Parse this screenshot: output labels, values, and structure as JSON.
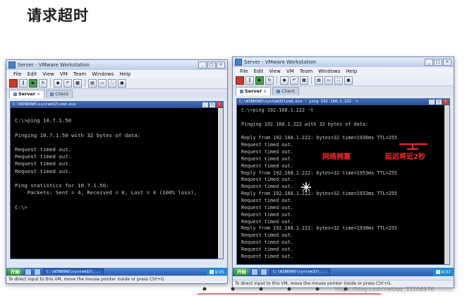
{
  "page": {
    "title": "请求超时"
  },
  "left_window": {
    "title": "Server - VMware Workstation",
    "menu": [
      "File",
      "Edit",
      "View",
      "VM",
      "Team",
      "Windows",
      "Help"
    ],
    "tabs": [
      {
        "label": "Server",
        "active": true
      },
      {
        "label": "Client",
        "active": false
      }
    ],
    "console_title": "C:\\WINDOWS\\system32\\cmd.exe",
    "lines": [
      "",
      "C:\\>ping 10.7.1.50",
      "",
      "Pinging 10.7.1.50 with 32 bytes of data:",
      "",
      "Request timed out.",
      "Request timed out.",
      "Request timed out.",
      "Request timed out.",
      "",
      "Ping statistics for 10.7.1.50:",
      "    Packets: Sent = 4, Received = 0, Lost = 4 (100% loss),",
      "",
      "C:\\>"
    ],
    "taskbar": {
      "start": "开始",
      "task": "C:\\WINDOWS\\system32\\...",
      "clock": "9:05"
    },
    "status": "To direct input to this VM, move the mouse pointer inside or press Ctrl+G."
  },
  "right_window": {
    "title": "Server - VMware Workstation",
    "menu": [
      "File",
      "Edit",
      "View",
      "VM",
      "Team",
      "Windows",
      "Help"
    ],
    "tabs": [
      {
        "label": "Server",
        "active": true
      },
      {
        "label": "Client",
        "active": false
      }
    ],
    "console_title": "C:\\WINDOWS\\system32\\cmd.exe - ping 192.168.1.222 -t",
    "lines": [
      "C:\\>ping 192.168.1.222 -t",
      "",
      "Pinging 192.168.1.222 with 32 bytes of data:",
      "",
      "Reply from 192.168.1.222: bytes=32 time=1936ms TTL=255",
      "Request timed out.",
      "Request timed out.",
      "Request timed out.",
      "Request timed out.",
      "Reply from 192.168.1.222: bytes=32 time=1953ms TTL=255",
      "Request timed out.",
      "Request timed out.",
      "Reply from 192.168.1.222: bytes=32 time=1933ms TTL=255",
      "Request timed out.",
      "Request timed out.",
      "Request timed out.",
      "Request timed out.",
      "Reply from 192.168.1.222: bytes=32 time=1938ms TTL=255",
      "Request timed out.",
      "Request timed out.",
      "Request timed out.",
      "Request timed out."
    ],
    "taskbar": {
      "start": "开始",
      "task": "C:\\WINDOWS\\system32\\...",
      "clock": "9:07"
    },
    "status": "To direct input to this VM, move the mouse pointer inside or press Ctrl+G."
  },
  "annotations": {
    "congestion": "网络拥塞",
    "delay": "延迟将近2秒"
  },
  "watermark": "https://blog.csdn.net/qq_33206976",
  "colors": {
    "annotation": "#ff2a2a",
    "console_bg": "#000000",
    "console_text": "#c8c8c8"
  }
}
